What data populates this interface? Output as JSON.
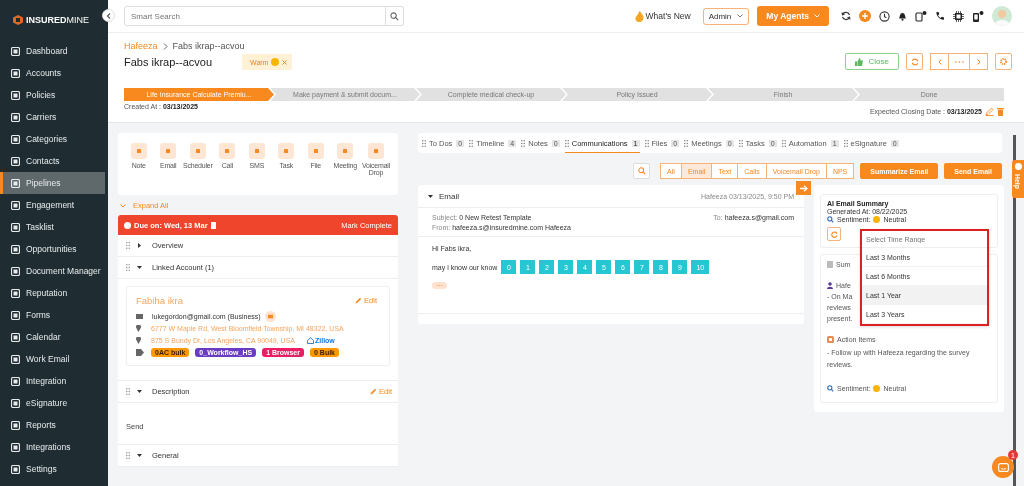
{
  "sidebar": {
    "logo": "**INSURED**MINE",
    "items": [
      {
        "label": "Dashboard",
        "selected": false
      },
      {
        "label": "Accounts",
        "selected": false
      },
      {
        "label": "Policies",
        "selected": false
      },
      {
        "label": "Carriers",
        "selected": false
      },
      {
        "label": "Categories",
        "selected": false
      },
      {
        "label": "Contacts",
        "selected": false
      },
      {
        "label": "Pipelines",
        "selected": true
      },
      {
        "label": "Engagement",
        "selected": false
      },
      {
        "label": "Tasklist",
        "selected": false
      },
      {
        "label": "Opportunities",
        "selected": false
      },
      {
        "label": "Document Manager",
        "selected": false
      },
      {
        "label": "Reputation",
        "selected": false
      },
      {
        "label": "Forms",
        "selected": false
      },
      {
        "label": "Calendar",
        "selected": false
      },
      {
        "label": "Work Email",
        "selected": false
      },
      {
        "label": "Integration",
        "selected": false
      },
      {
        "label": "eSignature",
        "selected": false
      },
      {
        "label": "Reports",
        "selected": false
      },
      {
        "label": "Integrations",
        "selected": false
      },
      {
        "label": "Settings",
        "selected": false
      }
    ]
  },
  "topbar": {
    "search_placeholder": "Smart Search",
    "whats_new": "What's New",
    "role": "Admin",
    "agents_button": "My Agents"
  },
  "header": {
    "breadcrumb": [
      "Hafeeza",
      "Fabs ikrap--acvou"
    ],
    "title": "Fabs ikrap--acvou",
    "tag": "Warm",
    "close_button": "Close",
    "stages": [
      {
        "label": "Life Insurance Calculate Premiu...",
        "selected": true
      },
      {
        "label": "Make payment & submit docum...",
        "selected": false
      },
      {
        "label": "Complete medical check-up",
        "selected": false
      },
      {
        "label": "Policy Issued",
        "selected": false
      },
      {
        "label": "Finish",
        "selected": false
      },
      {
        "label": "Done",
        "selected": false
      }
    ],
    "created_label": "Created At :",
    "created_date": "03/13/2025",
    "closing_label": "Expected Closing Date :",
    "closing_date": "03/13/2025"
  },
  "quick_actions": [
    "Note",
    "Email",
    "Scheduler",
    "Call",
    "SMS",
    "Task",
    "File",
    "Meeting",
    "Voicemail Drop"
  ],
  "expand_all": "Expand All",
  "due": {
    "text": "Due on: Wed, 13 Mar",
    "action": "Mark Complete"
  },
  "sections": [
    {
      "kind": "overview",
      "title": "Overview",
      "expanded": false
    },
    {
      "kind": "account",
      "title": "Linked Account (1)",
      "expanded": true,
      "account": {
        "name": "Fabiha ikra",
        "edit": "Edit",
        "email": "lukegordon@gmail.com (Business)",
        "addresses": [
          "6777 W Maple Rd, West Bloomfield Township, MI 48322, USA",
          "875 S Bundy Dr, Los Angeles, CA 90049, USA"
        ],
        "zillow": "Zillow",
        "tags": [
          {
            "label": "0AC bulk",
            "color": "#ff9800"
          },
          {
            "label": "0_Workflow_HS",
            "color": "#6a3cc4"
          },
          {
            "label": "1 Browser",
            "color": "#e91e63"
          },
          {
            "label": "0 Bulk",
            "color": "#ff9800"
          }
        ]
      }
    },
    {
      "kind": "description",
      "title": "Description",
      "expanded": true,
      "edit": "Edit",
      "text": "Send"
    },
    {
      "kind": "general",
      "title": "General",
      "expanded": true
    }
  ],
  "tabs": [
    {
      "label": "To Dos",
      "count": "0",
      "selected": false
    },
    {
      "label": "Timeline",
      "count": "4",
      "selected": false
    },
    {
      "label": "Notes",
      "count": "0",
      "selected": false
    },
    {
      "label": "Communications",
      "count": "1",
      "selected": true
    },
    {
      "label": "Files",
      "count": "0",
      "selected": false
    },
    {
      "label": "Meetings",
      "count": "0",
      "selected": false
    },
    {
      "label": "Tasks",
      "count": "0",
      "selected": false
    },
    {
      "label": "Automation",
      "count": "1",
      "selected": false
    },
    {
      "label": "eSignature",
      "count": "0",
      "selected": false
    }
  ],
  "filters": [
    {
      "label": "All",
      "selected": false
    },
    {
      "label": "Email",
      "selected": true
    },
    {
      "label": "Text",
      "selected": false
    },
    {
      "label": "Calls",
      "selected": false
    },
    {
      "label": "Voicemail Drop",
      "selected": false
    },
    {
      "label": "NPS",
      "selected": false
    }
  ],
  "actions": [
    "Summarize Email",
    "Send Email"
  ],
  "email": {
    "heading": "Email",
    "expanded": true,
    "meta": "Hafeeza 03/13/2025, 9:50 PM",
    "subject_label": "Subject:",
    "subject": "0 New Retest Template",
    "to_label": "To:",
    "to": "hafeeza.s@gmail.com",
    "from_label": "From:",
    "from": "hafeeza.s@insuredmine.com Hafeeza",
    "greeting": "Hi Fabs ikra,",
    "question": "may i know our know",
    "scale": [
      "0",
      "1",
      "2",
      "3",
      "4",
      "5",
      "6",
      "7",
      "8",
      "9",
      "10"
    ],
    "more": "···"
  },
  "ai_summary": {
    "title": "AI Email Summary",
    "generated": "Generated At: 08/22/2025",
    "sentiment_label": "Sentiment:",
    "sentiment": "Neutral",
    "summary_heading": "Sum",
    "person": "Hafe",
    "summary_lines": [
      "- On Ma",
      "reviews",
      "present."
    ],
    "action_heading": "Action Items",
    "action_text": "- Follow up with Hafeeza regarding the survey reviews.",
    "footer_sentiment_label": "Sentiment:",
    "footer_sentiment": "Neutral"
  },
  "time_range": {
    "placeholder": "Select Time Range",
    "options": [
      {
        "label": "Last 3 Months",
        "selected": false
      },
      {
        "label": "Last 6 Months",
        "selected": false
      },
      {
        "label": "Last 1 Year",
        "selected": true
      },
      {
        "label": "Last 3 Years",
        "selected": false
      }
    ]
  },
  "help_tab": "Help",
  "chat_badge": "1"
}
